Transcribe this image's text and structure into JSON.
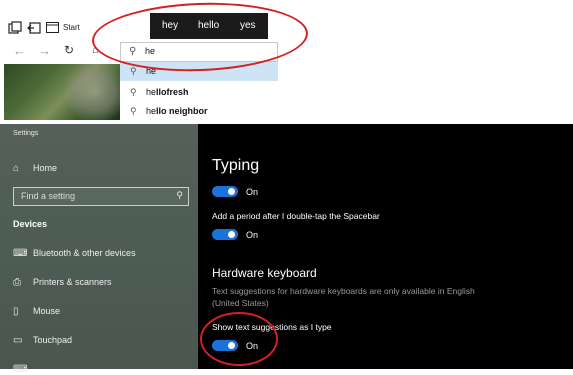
{
  "browser": {
    "tab_label": "Start",
    "address_value": "he",
    "suggestions": [
      {
        "text": "he"
      },
      {
        "text": "hellofresh"
      },
      {
        "text": "hello neighbor"
      }
    ],
    "predictions": [
      "hey",
      "hello",
      "yes"
    ]
  },
  "settings": {
    "window_title": "Settings",
    "home_label": "Home",
    "search_placeholder": "Find a setting",
    "section_header": "Devices",
    "nav_items": [
      {
        "label": "Bluetooth & other devices",
        "icon": "bluetooth-keyboard-icon"
      },
      {
        "label": "Printers & scanners",
        "icon": "printer-icon"
      },
      {
        "label": "Mouse",
        "icon": "mouse-icon"
      },
      {
        "label": "Touchpad",
        "icon": "touchpad-icon"
      }
    ],
    "content": {
      "typing_title": "Typing",
      "toggle_on_label": "On",
      "period_label": "Add a period after I double-tap the Spacebar",
      "hw_title": "Hardware keyboard",
      "hw_desc": "Text suggestions for hardware keyboards are only available in English (United States)",
      "show_suggest_label": "Show text suggestions as I type"
    }
  },
  "colors": {
    "accent": "#1a73d9",
    "annotation": "#d42020",
    "suggestion_highlight": "#cde4f7"
  }
}
